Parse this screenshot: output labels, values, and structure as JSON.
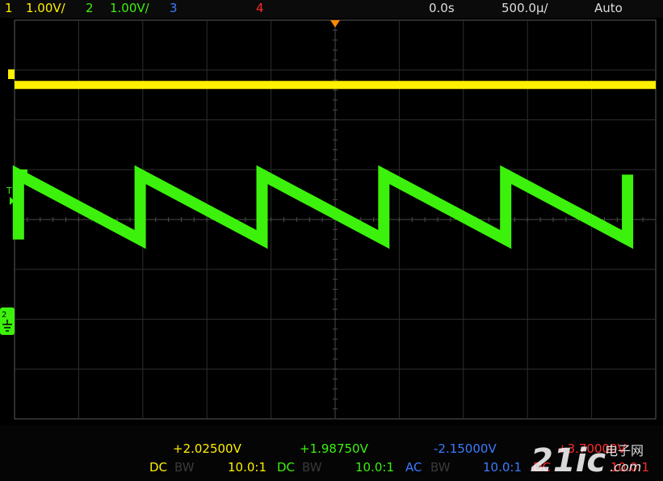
{
  "topbar": {
    "ch1_num": "1",
    "ch1_scale": "1.00V/",
    "ch2_num": "2",
    "ch2_scale": "1.00V/",
    "ch3_num": "3",
    "ch4_num": "4",
    "time_delay": "0.0s",
    "time_scale": "500.0µ/",
    "trigger_mode": "Auto"
  },
  "markers": {
    "trigger_level_label": "T",
    "ch2_marker": "2",
    "ground_symbol": "ground-icon"
  },
  "bottombar": {
    "ch1": {
      "offset": "+2.02500V",
      "coupling": "DC",
      "bw": "BW",
      "probe": "10.0:1"
    },
    "ch2": {
      "offset": "+1.98750V",
      "coupling": "DC",
      "bw": "BW",
      "probe": "10.0:1"
    },
    "ch3": {
      "offset": "-2.15000V",
      "coupling": "AC",
      "bw": "BW",
      "probe": "10.0:1"
    },
    "ch4": {
      "offset": "+3.70000V",
      "coupling": "DC",
      "probe": "10.0:1"
    }
  },
  "watermark": {
    "brand": "21ic",
    "cn": "电子网",
    "domain": ".com"
  },
  "colors": {
    "ch1": "#ffef00",
    "ch2": "#3cf20c",
    "ch3": "#3b7cff",
    "ch4": "#ff2a2a",
    "grid": "#2e2e2e",
    "trigger": "#ff8a00"
  },
  "chart_data": {
    "type": "line",
    "xlim": [
      -2.5,
      2.5
    ],
    "ylim": [
      -4,
      4
    ],
    "series": [
      {
        "x": [
          -2.5,
          2.5
        ],
        "y": [
          2.7,
          2.7
        ]
      },
      {
        "x": [
          -2.47,
          -2.47,
          -1.52,
          -1.52,
          -0.57,
          -0.57,
          0.38,
          0.38,
          1.33,
          1.33,
          2.28,
          2.28
        ],
        "y": [
          -0.4,
          0.9,
          -0.4,
          0.9,
          -0.4,
          0.9,
          -0.4,
          0.9,
          -0.4,
          0.9,
          -0.4,
          0.9
        ]
      }
    ]
  }
}
